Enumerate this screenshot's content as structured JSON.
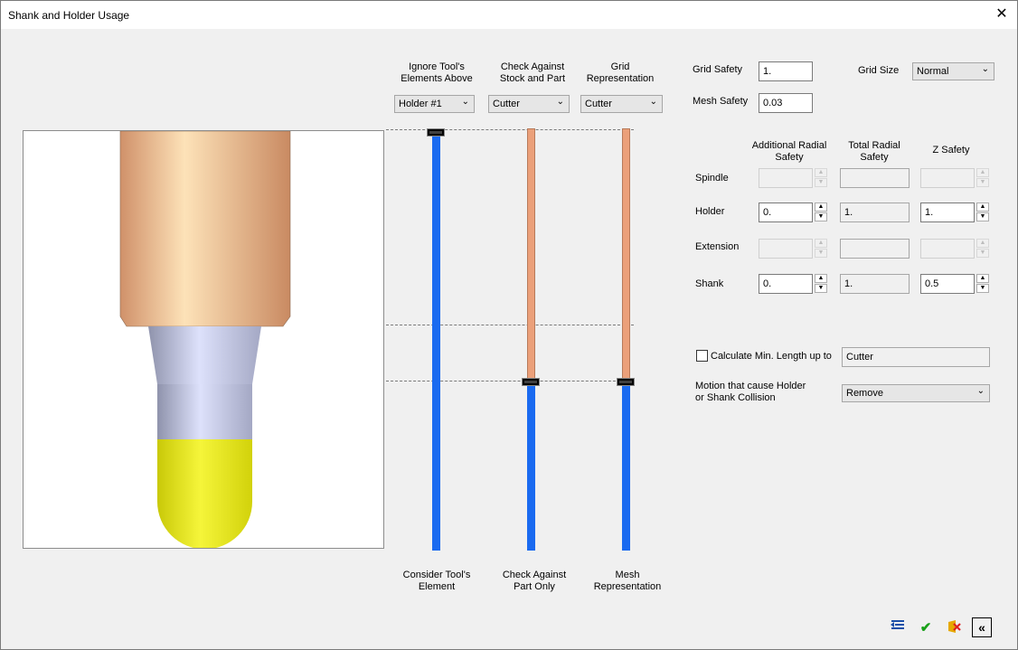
{
  "window": {
    "title": "Shank and Holder Usage"
  },
  "columns": {
    "ignore": {
      "header_line1": "Ignore Tool's",
      "header_line2": "Elements Above",
      "value": "Holder #1",
      "footer_line1": "Consider Tool's",
      "footer_line2": "Element"
    },
    "check": {
      "header_line1": "Check Against",
      "header_line2": "Stock and Part",
      "value": "Cutter",
      "footer_line1": "Check Against",
      "footer_line2": "Part Only"
    },
    "grid": {
      "header_line1": "Grid",
      "header_line2": "Representation",
      "value": "Cutter",
      "footer_line1": "Mesh",
      "footer_line2": "Representation"
    }
  },
  "grid_safety": {
    "label": "Grid Safety",
    "value": "1."
  },
  "mesh_safety": {
    "label": "Mesh Safety",
    "value": "0.03"
  },
  "grid_size": {
    "label": "Grid Size",
    "value": "Normal"
  },
  "table": {
    "headers": {
      "additional_line1": "Additional Radial",
      "additional_line2": "Safety",
      "total_line1": "Total Radial",
      "total_line2": "Safety",
      "z": "Z Safety"
    },
    "rows": {
      "spindle": {
        "label": "Spindle",
        "additional": "",
        "total": "",
        "z": ""
      },
      "holder": {
        "label": "Holder",
        "additional": "0.",
        "total": "1.",
        "z": "1."
      },
      "extension": {
        "label": "Extension",
        "additional": "",
        "total": "",
        "z": ""
      },
      "shank": {
        "label": "Shank",
        "additional": "0.",
        "total": "1.",
        "z": "0.5"
      }
    }
  },
  "calc_min_length": {
    "label": "Calculate Min. Length up to",
    "checked": false,
    "value": "Cutter"
  },
  "motion": {
    "label_line1": "Motion that cause Holder",
    "label_line2": "or Shank Collision",
    "value": "Remove"
  },
  "colors": {
    "holder": "#e8b088",
    "shank": "#c8cce8",
    "cutter": "#e6e61e",
    "slider_blue": "#1a6af0",
    "slider_orange": "#eba07a"
  },
  "icons": {
    "close": "close-icon",
    "load": "load-list-icon",
    "ok": "check-icon",
    "cancel": "cancel-icon",
    "collapse": "collapse-icon"
  }
}
